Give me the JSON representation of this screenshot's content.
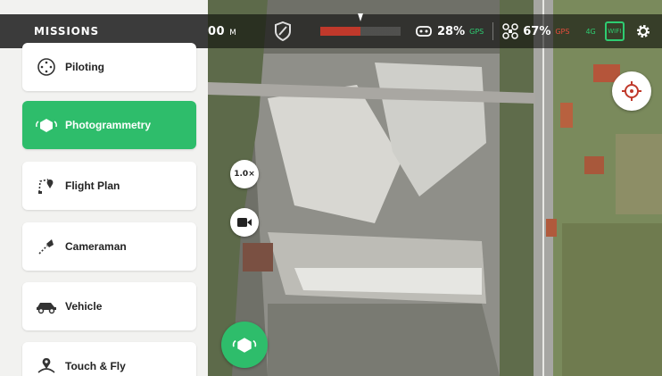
{
  "topbar": {
    "altitude": "00",
    "altitude_unit": "M",
    "controller_battery": "28%",
    "controller_gps": "GPS",
    "drone_battery": "67%",
    "drone_gps": "GPS",
    "network": "4G",
    "wifi": "WIFI"
  },
  "sidebar": {
    "title": "MISSIONS",
    "items": [
      {
        "label": "Piloting",
        "icon": "piloting-icon"
      },
      {
        "label": "Photogrammetry",
        "icon": "photogrammetry-icon",
        "active": true
      },
      {
        "label": "Flight Plan",
        "icon": "flight-plan-icon"
      },
      {
        "label": "Cameraman",
        "icon": "cameraman-icon"
      },
      {
        "label": "Vehicle",
        "icon": "vehicle-icon"
      },
      {
        "label": "Touch & Fly",
        "icon": "touch-fly-icon"
      }
    ]
  },
  "map_controls": {
    "zoom_label": "1.0×"
  },
  "colors": {
    "accent": "#2ebd6b",
    "sidebar_bg": "#f2f2f0",
    "header_bg": "#3b3b3b",
    "danger": "#c0392b"
  }
}
